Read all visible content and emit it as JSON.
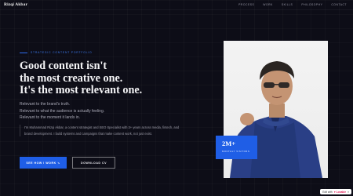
{
  "nav": {
    "logo": "Rizqi Akbar",
    "items": [
      "PROCESS",
      "WORK",
      "SKILLS",
      "PHILOSOPHY",
      "CONTACT"
    ]
  },
  "hero": {
    "eyebrow": "STRATEGIC CONTENT PORTFOLIO",
    "headline": [
      "Good content isn't",
      "the most creative one.",
      "It's the most relevant one."
    ],
    "sub": [
      "Relevant to the brand's truth.",
      "Relevant to what the audience is actually feeling.",
      "Relevant to the moment it lands in."
    ],
    "bio": "I'm Muhammad Rizqi Akbar, a content strategist and SEO Specialist with 3+ years across media, fintech, and brand development. I build systems and campaigns that make content work, not just exist.",
    "cta_primary": "SEE HOW I WORK ↘",
    "cta_secondary": "DOWNLOAD CV"
  },
  "stat": {
    "value": "2M+",
    "label": "MONTHLY VISITORS"
  },
  "badge": {
    "prefix": "Edit with",
    "brand": "♥ Lovable",
    "close": "×"
  },
  "colors": {
    "accent": "#1f5ee6",
    "background": "#0d0d17"
  }
}
